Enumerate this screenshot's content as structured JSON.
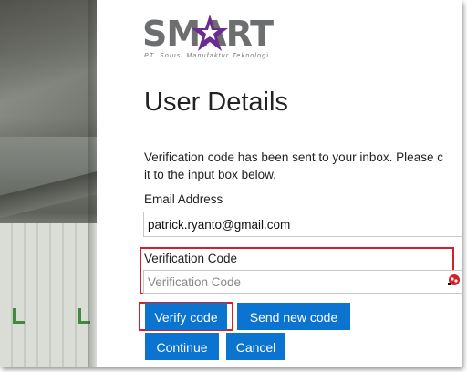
{
  "brand": {
    "logo_text": "SMART",
    "tagline": "PT. Solusi Manufaktur Teknologi",
    "accent_color": "#6a2c91"
  },
  "page": {
    "title": "User Details",
    "intro_line1": "Verification code has been sent to your inbox. Please c",
    "intro_line2": "it to the input box below."
  },
  "form": {
    "email_label": "Email Address",
    "email_value": "patrick.ryanto@gmail.com",
    "verification_label": "Verification Code",
    "verification_placeholder": "Verification Code",
    "verification_value": ""
  },
  "buttons": {
    "verify": "Verify code",
    "send_new": "Send new code",
    "continue": "Continue",
    "cancel": "Cancel"
  },
  "icons": {
    "autofill": "password-manager-icon"
  },
  "colors": {
    "button_bg": "#0b74d1",
    "highlight": "#d61f26"
  }
}
